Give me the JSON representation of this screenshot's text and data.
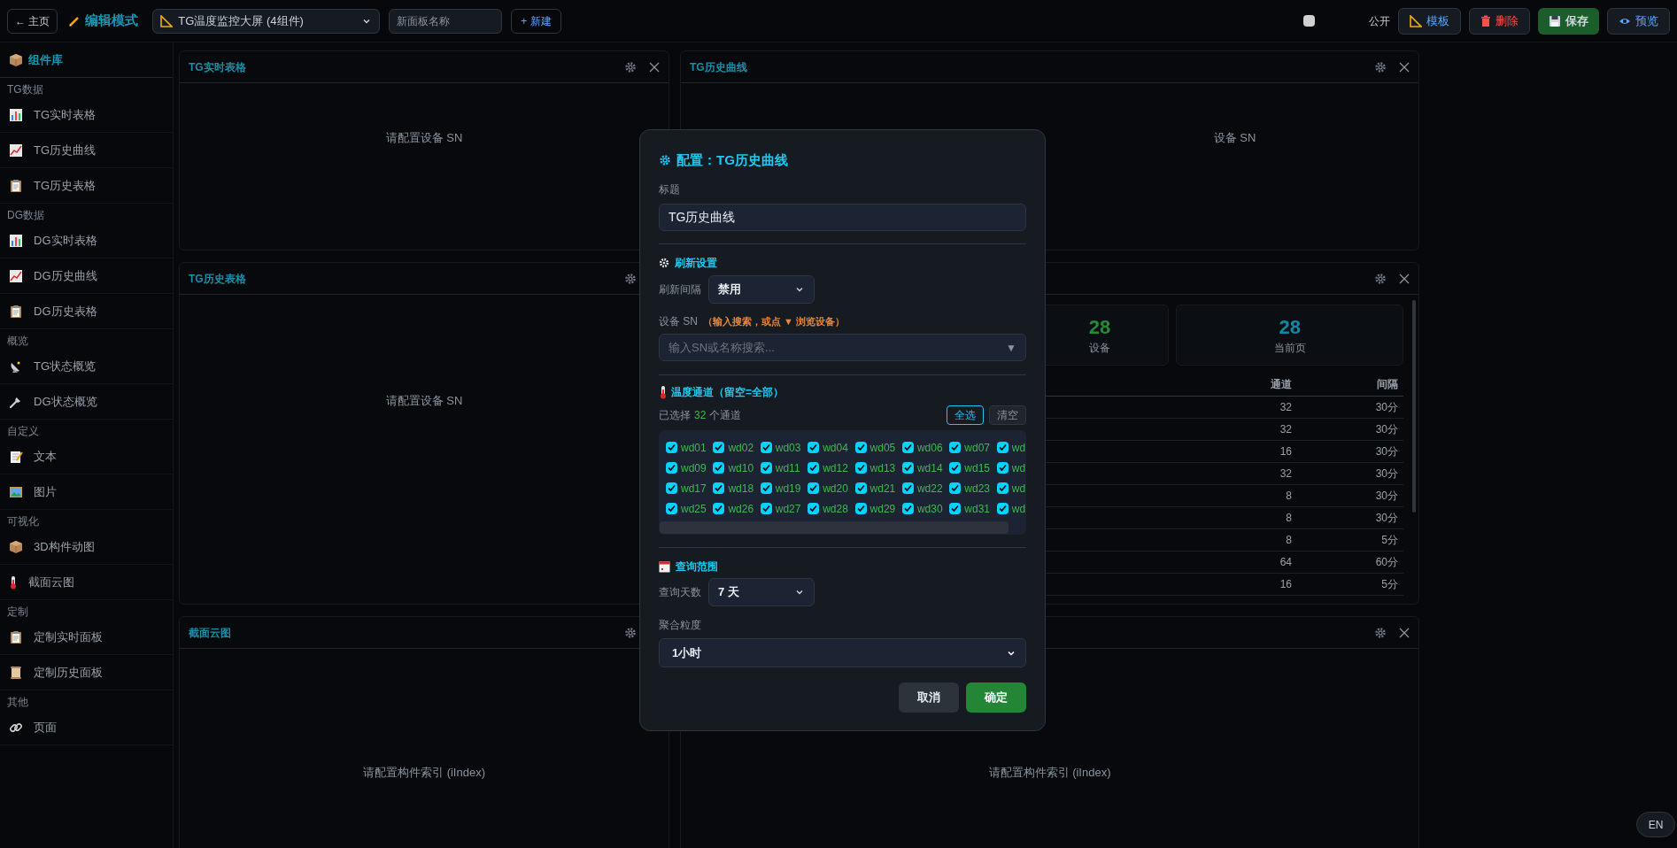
{
  "top_bar": {
    "home_button": "← 主页",
    "mode_title": "编辑模式",
    "dashboard_select": "TG温度监控大屏 (4组件)",
    "new_name_field": {
      "placeholder": "新面板名称"
    },
    "new_button": "+ 新建",
    "public_checkbox": {
      "checked": false
    },
    "public_label": "公开",
    "actions": [
      {
        "label": "模板",
        "kind": "template"
      },
      {
        "label": "删除",
        "kind": "danger"
      },
      {
        "label": "保存",
        "kind": "success"
      },
      {
        "label": "预览",
        "kind": "preview"
      }
    ]
  },
  "sidebar": {
    "title": "组件库",
    "groups": [
      {
        "label": "TG数据",
        "items": [
          "TG实时表格",
          "TG历史曲线",
          "TG历史表格"
        ]
      },
      {
        "label": "DG数据",
        "items": [
          "DG实时表格",
          "DG历史曲线",
          "DG历史表格"
        ]
      },
      {
        "label": "概览",
        "items": [
          "TG状态概览",
          "DG状态概览"
        ]
      },
      {
        "label": "自定义",
        "items": [
          "文本",
          "图片"
        ]
      },
      {
        "label": "可视化",
        "items": [
          "3D构件动图",
          "截面云图"
        ]
      },
      {
        "label": "定制",
        "items": [
          "定制实时面板",
          "定制历史面板"
        ]
      },
      {
        "label": "其他",
        "items": [
          "页面"
        ]
      }
    ]
  },
  "panels": [
    {
      "kind": "message",
      "title": "TG实时表格",
      "message": "请配置设备 SN"
    },
    {
      "kind": "message",
      "title": "TG历史曲线",
      "message": "设备 SN"
    },
    {
      "kind": "message",
      "title": "TG历史表格",
      "message": "请配置设备 SN"
    },
    {
      "kind": "status",
      "stats": [
        {
          "value": "28",
          "label": "设备",
          "color": "#268a36"
        },
        {
          "value": "28",
          "label": "当前页",
          "color": "#1088a4"
        }
      ],
      "table": {
        "columns": [
          "通道",
          "间隔"
        ],
        "rows": [
          [
            "32",
            "30分"
          ],
          [
            "32",
            "30分"
          ],
          [
            "16",
            "30分"
          ],
          [
            "32",
            "30分"
          ],
          [
            "8",
            "30分"
          ],
          [
            "8",
            "30分"
          ],
          [
            "8",
            "5分"
          ],
          [
            "64",
            "60分"
          ],
          [
            "16",
            "5分"
          ]
        ]
      }
    },
    {
      "kind": "message",
      "title": "截面云图",
      "message": "请配置构件索引 (iIndex)"
    },
    {
      "kind": "message",
      "message": "请配置构件索引 (iIndex)"
    }
  ],
  "dialog": {
    "title": "配置：TG历史曲线",
    "title_field": {
      "label": "标题",
      "value": "TG历史曲线"
    },
    "refresh": {
      "heading": "刷新设置",
      "interval_label": "刷新间隔",
      "interval_value": "禁用"
    },
    "device": {
      "label": "设备 SN",
      "hint": "（输入搜索，或点 ▼ 浏览设备）",
      "placeholder": "输入SN或名称搜索...",
      "dropdown_arrow": "▼"
    },
    "channels": {
      "heading": "温度通道（留空=全部）",
      "summary_prefix": "已选择",
      "count": "32",
      "summary_suffix": "个通道",
      "buttons": [
        {
          "label": "全选",
          "kind": "primary"
        },
        {
          "label": "清空",
          "kind": "secondary"
        }
      ],
      "items": [
        {
          "label": "wd01",
          "checked": true
        },
        {
          "label": "wd02",
          "checked": true
        },
        {
          "label": "wd03",
          "checked": true
        },
        {
          "label": "wd04",
          "checked": true
        },
        {
          "label": "wd05",
          "checked": true
        },
        {
          "label": "wd06",
          "checked": true
        },
        {
          "label": "wd07",
          "checked": true
        },
        {
          "label": "wd",
          "checked": true
        },
        {
          "label": "wd09",
          "checked": true
        },
        {
          "label": "wd10",
          "checked": true
        },
        {
          "label": "wd11",
          "checked": true
        },
        {
          "label": "wd12",
          "checked": true
        },
        {
          "label": "wd13",
          "checked": true
        },
        {
          "label": "wd14",
          "checked": true
        },
        {
          "label": "wd15",
          "checked": true
        },
        {
          "label": "wd",
          "checked": true
        },
        {
          "label": "wd17",
          "checked": true
        },
        {
          "label": "wd18",
          "checked": true
        },
        {
          "label": "wd19",
          "checked": true
        },
        {
          "label": "wd20",
          "checked": true
        },
        {
          "label": "wd21",
          "checked": true
        },
        {
          "label": "wd22",
          "checked": true
        },
        {
          "label": "wd23",
          "checked": true
        },
        {
          "label": "wd",
          "checked": true
        },
        {
          "label": "wd25",
          "checked": true
        },
        {
          "label": "wd26",
          "checked": true
        },
        {
          "label": "wd27",
          "checked": true
        },
        {
          "label": "wd28",
          "checked": true
        },
        {
          "label": "wd29",
          "checked": true
        },
        {
          "label": "wd30",
          "checked": true
        },
        {
          "label": "wd31",
          "checked": true
        },
        {
          "label": "wd",
          "checked": true
        }
      ]
    },
    "query": {
      "heading": "查询范围",
      "days_label": "查询天数",
      "days_value": "7 天",
      "granularity_label": "聚合粒度",
      "granularity_value": "1小时"
    },
    "buttons": [
      {
        "label": "取消",
        "kind": "cancel"
      },
      {
        "label": "确定",
        "kind": "confirm"
      }
    ]
  },
  "language_button": "EN"
}
